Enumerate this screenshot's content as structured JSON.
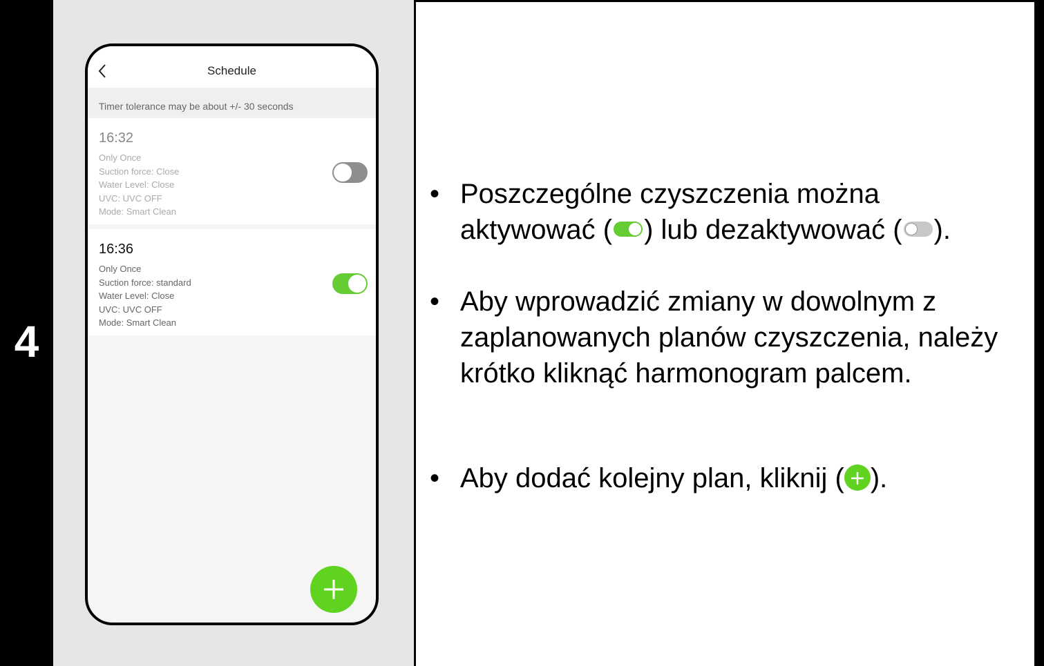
{
  "step": {
    "number": "4"
  },
  "phone": {
    "title": "Schedule",
    "tolerance_note": "Timer tolerance may be about +/- 30 seconds",
    "schedules": [
      {
        "time": "16:32",
        "repeat": "Only Once",
        "suction": "Suction force: Close",
        "water": "Water Level: Close",
        "uvc": "UVC: UVC OFF",
        "mode": "Mode: Smart Clean",
        "enabled": false
      },
      {
        "time": "16:36",
        "repeat": "Only Once",
        "suction": "Suction force: standard",
        "water": "Water Level: Close",
        "uvc": "UVC: UVC OFF",
        "mode": "Mode: Smart Clean",
        "enabled": true
      }
    ]
  },
  "instructions": {
    "bullet_symbol": "•",
    "b1_part1": "Poszczególne czyszczenia można aktywować (",
    "b1_part2": ") lub dezaktywować (",
    "b1_part3": ").",
    "b2": "Aby wprowadzić zmiany w dowolnym z zaplanowanych planów czyszczenia, należy krótko kliknąć harmonogram palcem.",
    "b3_part1": "Aby dodać kolejny plan, kliknij (",
    "b3_part2": ")."
  },
  "colors": {
    "toggle_on": "#66cc33",
    "toggle_off": "#8e8e8e",
    "fab": "#5fd320"
  },
  "icons": [
    "back-chevron-icon",
    "plus-icon"
  ]
}
